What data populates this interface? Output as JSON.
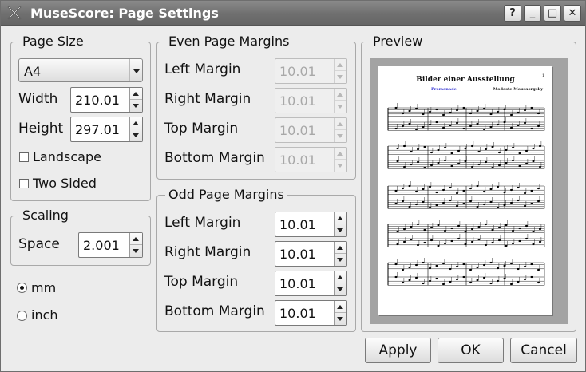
{
  "window": {
    "title": "MuseScore: Page Settings",
    "app_icon": "musescore-x-icon",
    "controls": {
      "help": "?",
      "minimize": "_",
      "maximize": "□",
      "close": "✕"
    }
  },
  "page_size": {
    "group_title": "Page Size",
    "paper": "A4",
    "width_label": "Width",
    "width_value": "210.01",
    "height_label": "Height",
    "height_value": "297.01",
    "landscape_label": "Landscape",
    "landscape_checked": false,
    "two_sided_label": "Two Sided",
    "two_sided_checked": false
  },
  "scaling": {
    "group_title": "Scaling",
    "space_label": "Space",
    "space_value": "2.001"
  },
  "units": {
    "mm_label": "mm",
    "inch_label": "inch",
    "selected": "mm"
  },
  "even_margins": {
    "group_title": "Even Page Margins",
    "left_label": "Left Margin",
    "left_value": "10.01",
    "right_label": "Right Margin",
    "right_value": "10.01",
    "top_label": "Top Margin",
    "top_value": "10.01",
    "bottom_label": "Bottom Margin",
    "bottom_value": "10.01",
    "enabled": false
  },
  "odd_margins": {
    "group_title": "Odd Page Margins",
    "left_label": "Left Margin",
    "left_value": "10.01",
    "right_label": "Right Margin",
    "right_value": "10.01",
    "top_label": "Top Margin",
    "top_value": "10.01",
    "bottom_label": "Bottom Margin",
    "bottom_value": "10.01",
    "enabled": true
  },
  "preview": {
    "group_title": "Preview",
    "score_title": "Bilder einer Ausstellung",
    "score_subtitle": "Promenade",
    "composer": "Modeste Moussorgsky",
    "page_number": "1"
  },
  "buttons": {
    "apply": "Apply",
    "ok": "OK",
    "cancel": "Cancel"
  }
}
